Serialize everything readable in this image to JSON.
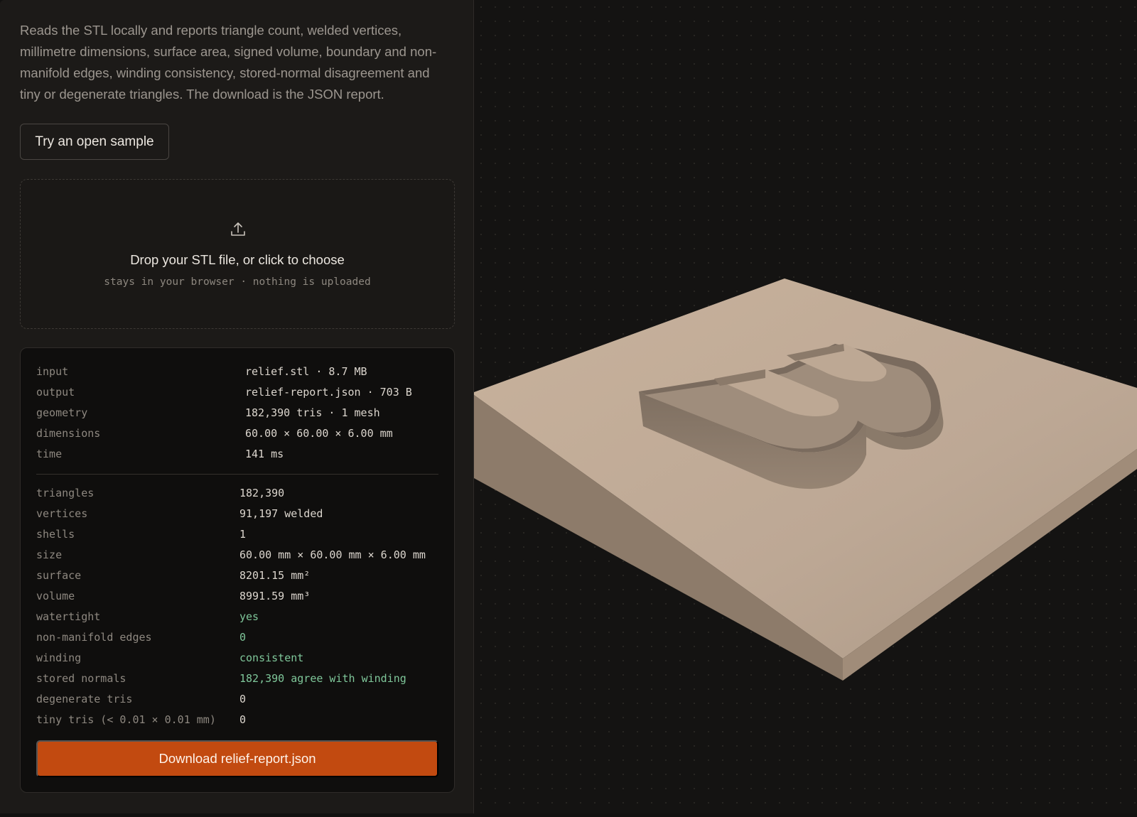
{
  "intro_text": "Reads the STL locally and reports triangle count, welded vertices, millimetre dimensions, surface area, signed volume, boundary and non-manifold edges, winding consistency, stored-normal disagreement and tiny or degenerate triangles. The download is the JSON report.",
  "sample_button": "Try an open sample",
  "dropzone": {
    "icon": "upload-icon",
    "title": "Drop your STL file, or click to choose",
    "subtitle": "stays in your browser · nothing is uploaded"
  },
  "summary": [
    {
      "key": "input",
      "value": "relief.stl · 8.7 MB"
    },
    {
      "key": "output",
      "value": "relief-report.json · 703 B"
    },
    {
      "key": "geometry",
      "value": "182,390 tris · 1 mesh"
    },
    {
      "key": "dimensions",
      "value": "60.00 × 60.00 × 6.00 mm"
    },
    {
      "key": "time",
      "value": "141 ms"
    }
  ],
  "stats": [
    {
      "key": "triangles",
      "value": "182,390",
      "status": "normal"
    },
    {
      "key": "vertices",
      "value": "91,197 welded",
      "status": "normal"
    },
    {
      "key": "shells",
      "value": "1",
      "status": "normal"
    },
    {
      "key": "size",
      "value": "60.00 mm × 60.00 mm × 6.00 mm",
      "status": "normal"
    },
    {
      "key": "surface",
      "value": "8201.15 mm²",
      "status": "normal"
    },
    {
      "key": "volume",
      "value": "8991.59 mm³",
      "status": "normal"
    },
    {
      "key": "watertight",
      "value": "yes",
      "status": "ok"
    },
    {
      "key": "non-manifold edges",
      "value": "0",
      "status": "ok"
    },
    {
      "key": "winding",
      "value": "consistent",
      "status": "ok"
    },
    {
      "key": "stored normals",
      "value": "182,390 agree with winding",
      "status": "ok"
    },
    {
      "key": "degenerate tris",
      "value": "0",
      "status": "normal"
    },
    {
      "key": "tiny tris (< 0.01 × 0.01 mm)",
      "value": "0",
      "status": "normal"
    }
  ],
  "download_button": "Download relief-report.json",
  "colors": {
    "accent": "#c24a10",
    "ok": "#7fc79a",
    "model": "#bca793"
  }
}
